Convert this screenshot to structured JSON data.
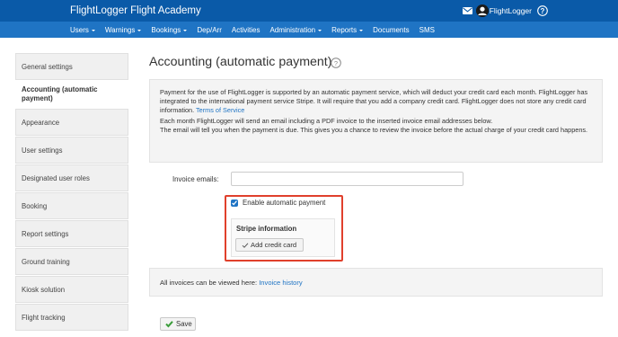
{
  "app": {
    "title": "FlightLogger Flight Academy"
  },
  "header": {
    "user_name": "FlightLogger"
  },
  "nav": {
    "items": [
      {
        "label": "Users",
        "dropdown": true
      },
      {
        "label": "Warnings",
        "dropdown": true
      },
      {
        "label": "Bookings",
        "dropdown": true
      },
      {
        "label": "Dep/Arr",
        "dropdown": false
      },
      {
        "label": "Activities",
        "dropdown": false
      },
      {
        "label": "Administration",
        "dropdown": true
      },
      {
        "label": "Reports",
        "dropdown": true
      },
      {
        "label": "Documents",
        "dropdown": false
      },
      {
        "label": "SMS",
        "dropdown": false
      }
    ]
  },
  "sidebar": {
    "items": [
      {
        "label": "General settings",
        "active": false
      },
      {
        "label": "Accounting (automatic payment)",
        "active": true
      },
      {
        "label": "Appearance",
        "active": false
      },
      {
        "label": "User settings",
        "active": false
      },
      {
        "label": "Designated user roles",
        "active": false
      },
      {
        "label": "Booking",
        "active": false
      },
      {
        "label": "Report settings",
        "active": false
      },
      {
        "label": "Ground training",
        "active": false
      },
      {
        "label": "Kiosk solution",
        "active": false
      },
      {
        "label": "Flight tracking",
        "active": false
      }
    ]
  },
  "main": {
    "title": "Accounting (automatic payment)",
    "info": {
      "p1": "Payment for the use of FlightLogger is supported by an automatic payment service, which will deduct your credit card each month. FlightLogger has integrated to the international payment service Stripe. It will require that you add a company credit card. FlightLogger does not store any credit card information.",
      "terms_link": "Terms of Service",
      "p2": "Each month FlightLogger will send an email including a PDF invoice to the inserted invoice email addresses below.",
      "p3": "The email will tell you when the payment is due. This gives you a chance to review the invoice before the actual charge of your credit card happens."
    },
    "invoice_emails_label": "Invoice emails:",
    "invoice_emails_value": "",
    "enable_label": "Enable automatic payment",
    "enable_checked": true,
    "stripe_title": "Stripe information",
    "add_card_label": "Add credit card",
    "history_text": "All invoices can be viewed here:",
    "history_link": "Invoice history",
    "save_label": "Save"
  },
  "colors": {
    "topbar": "#0a5aa8",
    "navbar": "#1f74c4",
    "link": "#1f74c4",
    "highlight": "#e0402c",
    "save_check": "#3a9d3a"
  }
}
